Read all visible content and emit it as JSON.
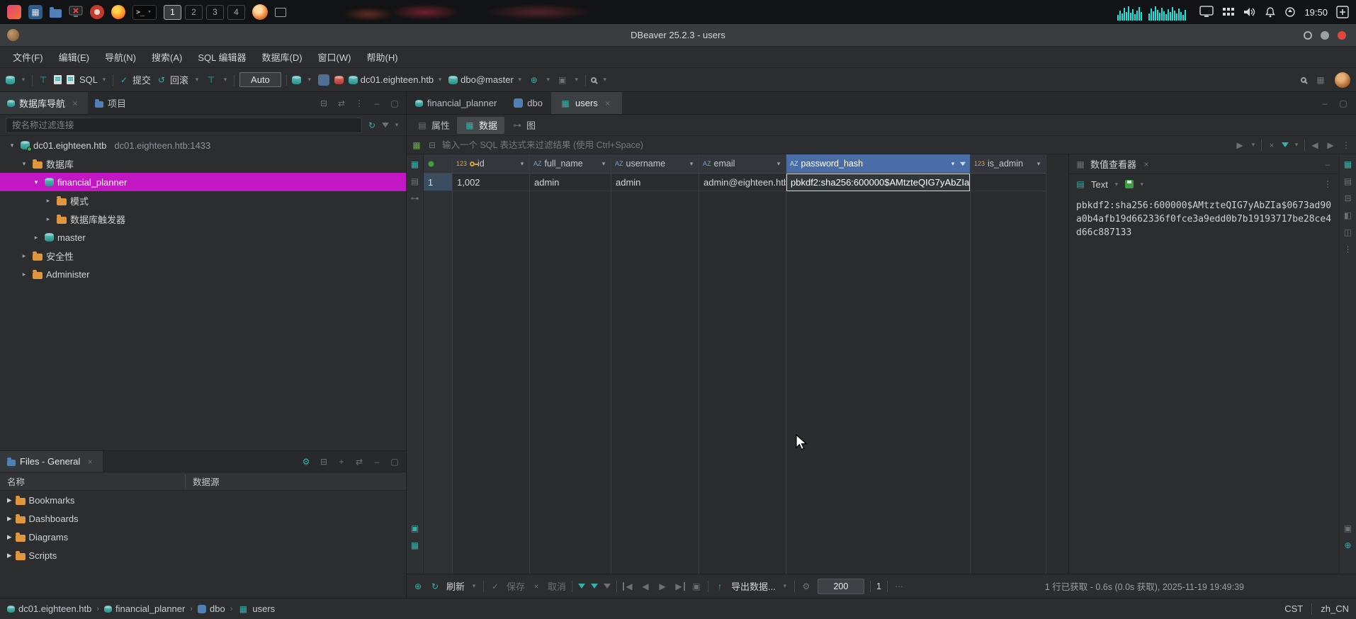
{
  "taskbar": {
    "terminal_label": ">_",
    "workspaces": [
      "1",
      "2",
      "3",
      "4"
    ],
    "active_workspace": "1",
    "time": "19:50"
  },
  "window": {
    "title": "DBeaver 25.2.3 - users"
  },
  "menu": {
    "items": [
      "文件(F)",
      "编辑(E)",
      "导航(N)",
      "搜索(A)",
      "SQL 编辑器",
      "数据库(D)",
      "窗口(W)",
      "帮助(H)"
    ]
  },
  "toolbar": {
    "sql": "SQL",
    "commit": "提交",
    "rollback": "回滚",
    "auto": "Auto",
    "connection": "dc01.eighteen.htb",
    "database": "dbo@master"
  },
  "navigator": {
    "title": "数据库导航",
    "projects": "项目",
    "filter_placeholder": "按名称过滤连接",
    "tree": [
      {
        "label": "dc01.eighteen.htb",
        "detail": "dc01.eighteen.htb:1433"
      },
      {
        "label": "数据库"
      },
      {
        "label": "financial_planner"
      },
      {
        "label": "模式"
      },
      {
        "label": "数据库触发器"
      },
      {
        "label": "master"
      },
      {
        "label": "安全性"
      },
      {
        "label": "Administer"
      }
    ]
  },
  "files": {
    "title": "Files - General",
    "col_name": "名称",
    "col_source": "数据源",
    "items": [
      "Bookmarks",
      "Dashboards",
      "Diagrams",
      "Scripts"
    ]
  },
  "editor": {
    "tabs": [
      {
        "label": "financial_planner"
      },
      {
        "label": "dbo"
      },
      {
        "label": "users"
      }
    ],
    "subtabs": [
      {
        "label": "属性"
      },
      {
        "label": "数据"
      },
      {
        "label": "图"
      }
    ],
    "filter_placeholder": "输入一个 SQL 表达式来过滤结果 (使用 Ctrl+Space)"
  },
  "grid": {
    "columns": [
      {
        "badge": "123",
        "name": "id"
      },
      {
        "badge": "AZ",
        "name": "full_name"
      },
      {
        "badge": "AZ",
        "name": "username"
      },
      {
        "badge": "AZ",
        "name": "email"
      },
      {
        "badge": "AZ",
        "name": "password_hash"
      },
      {
        "badge": "123",
        "name": "is_admin"
      }
    ],
    "row": {
      "num": "1",
      "cells": [
        "1,002",
        "admin",
        "admin",
        "admin@eighteen.htb",
        "pbkdf2:sha256:600000$AMtzteQIG7yAbZIa$06",
        ""
      ]
    }
  },
  "value_viewer": {
    "title": "数值查看器",
    "mode": "Text",
    "value": "pbkdf2:sha256:600000$AMtzteQIG7yAbZIa$0673ad90a0b4afb19d662336f0fce3a9edd0b7b19193717be28ce4d66c887133"
  },
  "grid_toolbar": {
    "refresh": "刷新",
    "save": "保存",
    "cancel": "取消",
    "export": "导出数据...",
    "fetch_size": "200",
    "row_count": "1",
    "status": "1 行已获取 - 0.6s (0.0s 获取), 2025-11-19 19:49:39"
  },
  "statusbar": {
    "breadcrumbs": [
      "dc01.eighteen.htb",
      "financial_planner",
      "dbo",
      "users"
    ],
    "timezone": "CST",
    "locale": "zh_CN"
  }
}
